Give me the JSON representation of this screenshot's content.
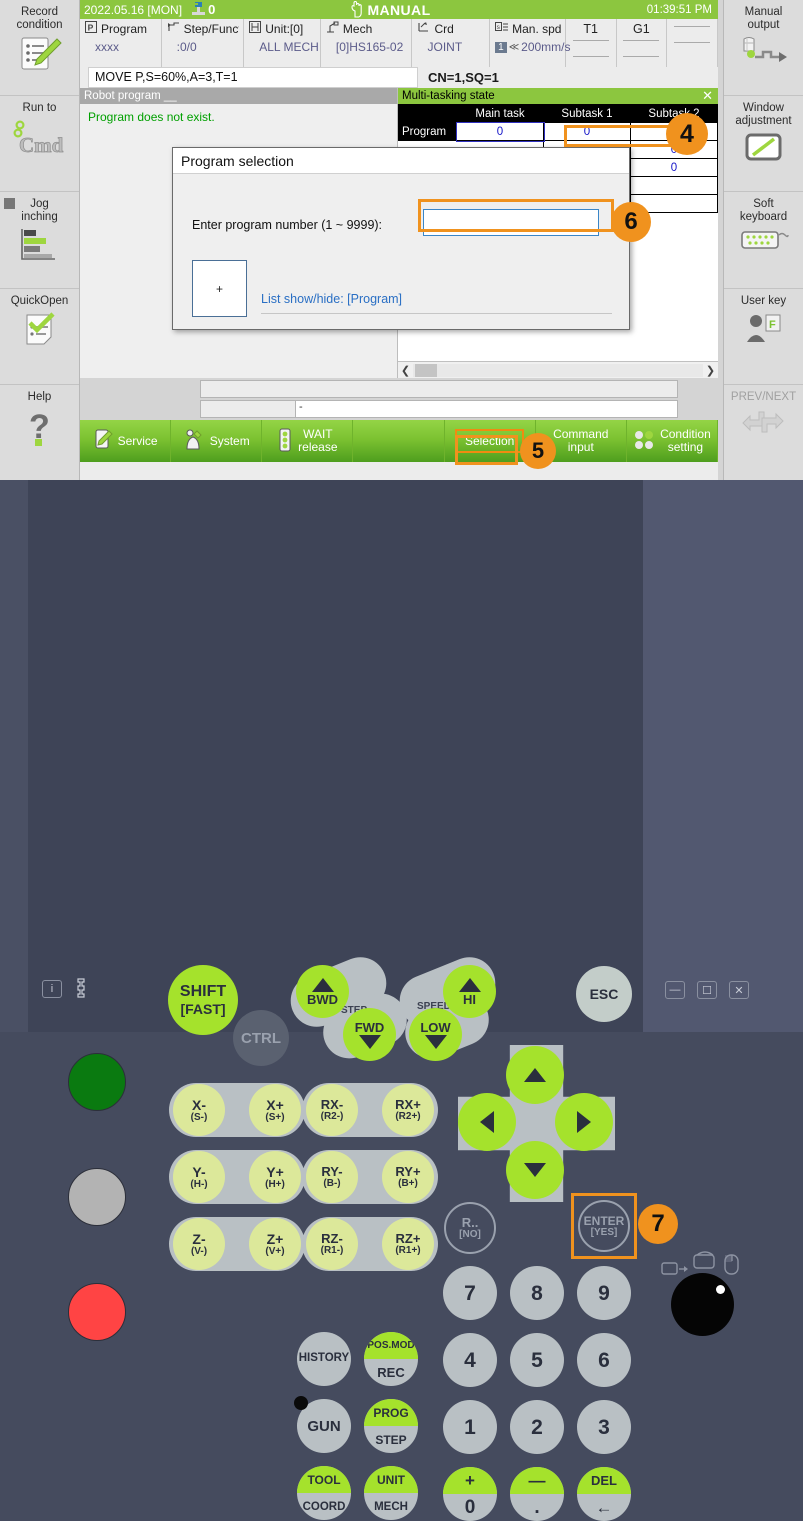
{
  "screen": {
    "titlebar": {
      "date": "2022.05.16 [MON]",
      "unit_number": "0",
      "mode": "MANUAL",
      "time": "01:39:51 PM",
      "unit_icon": "robot-unit-icon",
      "hand_icon": "hand-icon"
    },
    "info_cells": [
      {
        "icon": "program-icon",
        "label": "Program",
        "value": "xxxx"
      },
      {
        "icon": "step-icon",
        "label": "Step/Function",
        "value": ":0/0"
      },
      {
        "icon": "unit-icon",
        "label": "Unit:[0]",
        "value": "ALL MECH"
      },
      {
        "icon": "mech-icon",
        "label": "Mech",
        "value": "[0]HS165-02"
      },
      {
        "icon": "coord-icon",
        "label": "Crd",
        "value": "JOINT"
      },
      {
        "icon": "speed-icon",
        "label": "Man. spd.",
        "value": "200mm/s",
        "badge": "1"
      }
    ],
    "toggle_cells": [
      {
        "label": "T1"
      },
      {
        "label": "G1"
      },
      {
        "label": ""
      }
    ],
    "command_line": "MOVE P,S=60%,A=3,T=1",
    "cn_sq": "CN=1,SQ=1",
    "left_pane": {
      "header": "Robot program __",
      "message": "Program does not exist."
    },
    "multitask": {
      "header": "Multi-tasking state",
      "close_icon": "close-icon",
      "columns": [
        "",
        "Main task",
        "Subtask 1",
        "Subtask 2"
      ],
      "rows": [
        {
          "label": "Program",
          "values": [
            "0",
            "0",
            "0"
          ]
        },
        {
          "label": "",
          "values": [
            "",
            "",
            "0"
          ]
        },
        {
          "label": "",
          "values": [
            "",
            "",
            "0"
          ]
        },
        {
          "label": "",
          "values": [
            "",
            "",
            ""
          ]
        },
        {
          "label": "",
          "values": [
            "",
            "",
            ""
          ]
        },
        {
          "label": "",
          "values": [
            "",
            "",
            ""
          ]
        }
      ],
      "scroll_left_icon": "chevron-left-icon",
      "scroll_right_icon": "chevron-right-icon"
    },
    "dialog": {
      "title": "Program selection",
      "prompt": "Enter program number (1 ~ 9999):",
      "input_value": "",
      "plus_button": "+",
      "list_link": "List show/hide: [Program]"
    },
    "bottom_strip_text": "-",
    "function_bar": [
      {
        "icon": "service-icon",
        "label": "Service"
      },
      {
        "icon": "system-icon",
        "label": "System"
      },
      {
        "icon": "wait-icon",
        "label": "WAIT\nrelease",
        "l1": "WAIT",
        "l2": "release"
      },
      {
        "icon": "",
        "label": ""
      },
      {
        "icon": "",
        "label": "Selection",
        "boxed": true
      },
      {
        "icon": "",
        "label": "Command input",
        "l1": "Command",
        "l2": "input"
      },
      {
        "icon": "condition-icon",
        "label": "Condition setting",
        "l1": "Condition",
        "l2": "setting"
      }
    ],
    "left_rail": [
      {
        "label": "Record condition",
        "l1": "Record",
        "l2": "condition",
        "icon": "record-condition-icon"
      },
      {
        "label": "Run to",
        "l1": "Run to",
        "l2": "",
        "icon": "run-to-cmd-icon"
      },
      {
        "label": "Jog inching",
        "l1": "Jog",
        "l2": "inching",
        "icon": "jog-inching-icon",
        "marker": true
      },
      {
        "label": "QuickOpen",
        "l1": "QuickOpen",
        "l2": "",
        "icon": "quickopen-icon"
      },
      {
        "label": "Help",
        "l1": "Help",
        "l2": "",
        "icon": "help-icon"
      }
    ],
    "right_rail": [
      {
        "label": "Manual output",
        "l1": "Manual",
        "l2": "output",
        "icon": "manual-output-icon"
      },
      {
        "label": "Window adjustment",
        "l1": "Window",
        "l2": "adjustment",
        "icon": "window-adjustment-icon"
      },
      {
        "label": "Soft keyboard",
        "l1": "Soft",
        "l2": "keyboard",
        "icon": "soft-keyboard-icon"
      },
      {
        "label": "User key",
        "l1": "User key",
        "l2": "",
        "icon": "user-key-icon"
      },
      {
        "label": "PREV/NEXT",
        "l1": "PREV/NEXT",
        "l2": "",
        "icon": "prev-next-icon",
        "dim": true
      }
    ]
  },
  "callouts": [
    {
      "n": "4"
    },
    {
      "n": "5"
    },
    {
      "n": "6"
    },
    {
      "n": "7"
    }
  ],
  "pendant": {
    "shift": {
      "l1": "SHIFT",
      "l2": "[FAST]"
    },
    "ctrl": "CTRL",
    "step_group": {
      "label": "STEP",
      "bwd": "BWD",
      "fwd": "FWD"
    },
    "speed_group": {
      "label": "SPEED",
      "hi": "HI",
      "low": "LOW"
    },
    "esc": "ESC",
    "axis_keys": [
      {
        "main": "X-",
        "sub": "(S-)"
      },
      {
        "main": "X+",
        "sub": "(S+)"
      },
      {
        "main": "RX-",
        "sub": "(R2-)"
      },
      {
        "main": "RX+",
        "sub": "(R2+)"
      },
      {
        "main": "Y-",
        "sub": "(H-)"
      },
      {
        "main": "Y+",
        "sub": "(H+)"
      },
      {
        "main": "RY-",
        "sub": "(B-)"
      },
      {
        "main": "RY+",
        "sub": "(B+)"
      },
      {
        "main": "Z-",
        "sub": "(V-)"
      },
      {
        "main": "Z+",
        "sub": "(V+)"
      },
      {
        "main": "RZ-",
        "sub": "(R1-)"
      },
      {
        "main": "RZ+",
        "sub": "(R1+)"
      }
    ],
    "r_no": {
      "main": "R..",
      "sub": "[NO]"
    },
    "enter": {
      "main": "ENTER",
      "sub": "[YES]"
    },
    "numpad": [
      "7",
      "8",
      "9",
      "4",
      "5",
      "6",
      "1",
      "2",
      "3"
    ],
    "numpad_bottom": [
      {
        "top": "+",
        "bot": "0"
      },
      {
        "top": "—",
        "bot": "."
      },
      {
        "top": "DEL",
        "bot": "←"
      }
    ],
    "func_keys": [
      {
        "label": "HISTORY"
      },
      {
        "top": "POS.MOD",
        "bot": "REC"
      },
      {
        "label": "GUN"
      },
      {
        "top": "PROG",
        "bot": "STEP"
      },
      {
        "top": "TOOL",
        "bot": "COORD"
      },
      {
        "top": "UNIT",
        "bot": "MECH"
      }
    ],
    "lamps": [
      {
        "name": "motor-on-lamp",
        "color": "#0a7a10"
      },
      {
        "name": "standby-lamp",
        "color": "#b3b3b3"
      },
      {
        "name": "emergency-lamp",
        "color": "#ff4444"
      }
    ],
    "icons": [
      "info-icon",
      "wrench-icon",
      "minimize-icon",
      "restore-icon",
      "close-icon",
      "window-switch-icon",
      "window-cycle-icon",
      "mouse-icon",
      "trackball"
    ]
  },
  "colors": {
    "accent_green": "#8cc63f",
    "callout_orange": "#f0921e",
    "key_green": "#a5e22c",
    "pendant_bg": "#454b5e"
  }
}
